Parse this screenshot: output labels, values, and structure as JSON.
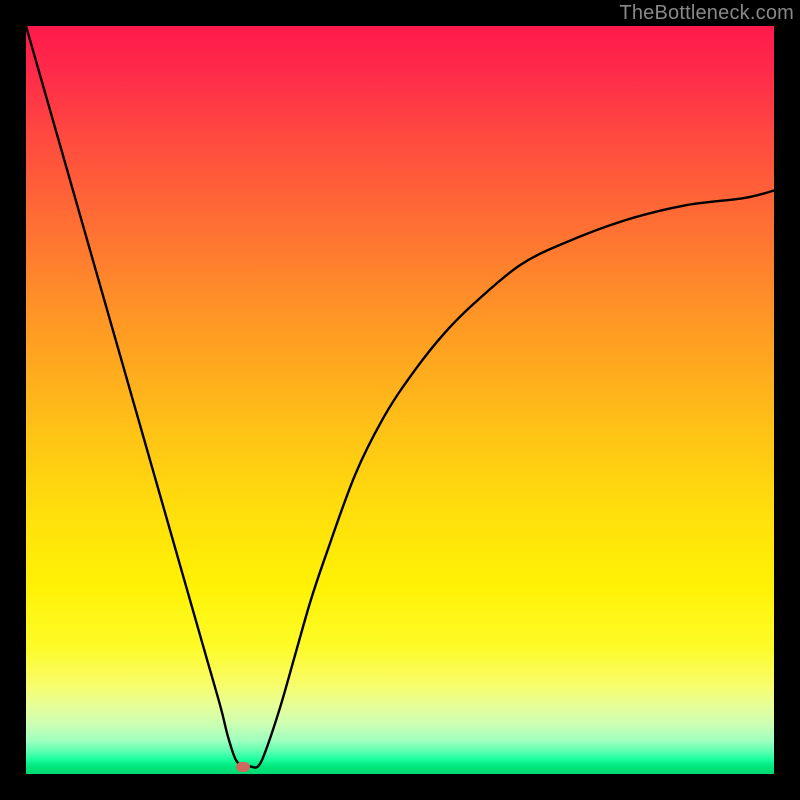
{
  "watermark": "TheBottleneck.com",
  "chart_data": {
    "type": "line",
    "title": "",
    "xlabel": "",
    "ylabel": "",
    "xlim": [
      0,
      100
    ],
    "ylim": [
      0,
      100
    ],
    "grid": false,
    "legend": false,
    "background": {
      "type": "vertical-gradient",
      "meaning": "bottleneck severity (red high → green low)",
      "stops": [
        {
          "pos": 0,
          "color": "#ff1a4b"
        },
        {
          "pos": 50,
          "color": "#ffc515"
        },
        {
          "pos": 85,
          "color": "#fdfb28"
        },
        {
          "pos": 100,
          "color": "#00d86f"
        }
      ]
    },
    "series": [
      {
        "name": "bottleneck-curve",
        "x": [
          0,
          2,
          4,
          6,
          8,
          10,
          12,
          14,
          16,
          18,
          20,
          22,
          24,
          26,
          27,
          28,
          29,
          30,
          31,
          32,
          34,
          36,
          38,
          40,
          44,
          48,
          52,
          56,
          60,
          66,
          72,
          80,
          88,
          96,
          100
        ],
        "y": [
          100,
          93,
          86,
          79,
          72,
          65,
          58,
          51,
          44,
          37,
          30,
          23,
          16,
          9,
          5,
          2,
          1,
          1,
          1,
          3,
          9,
          16,
          23,
          29,
          40,
          48,
          54,
          59,
          63,
          68,
          71,
          74,
          76,
          77,
          78
        ]
      }
    ],
    "marker": {
      "name": "optimal-point",
      "x": 29,
      "y": 1,
      "color": "#cc6a5e"
    }
  }
}
